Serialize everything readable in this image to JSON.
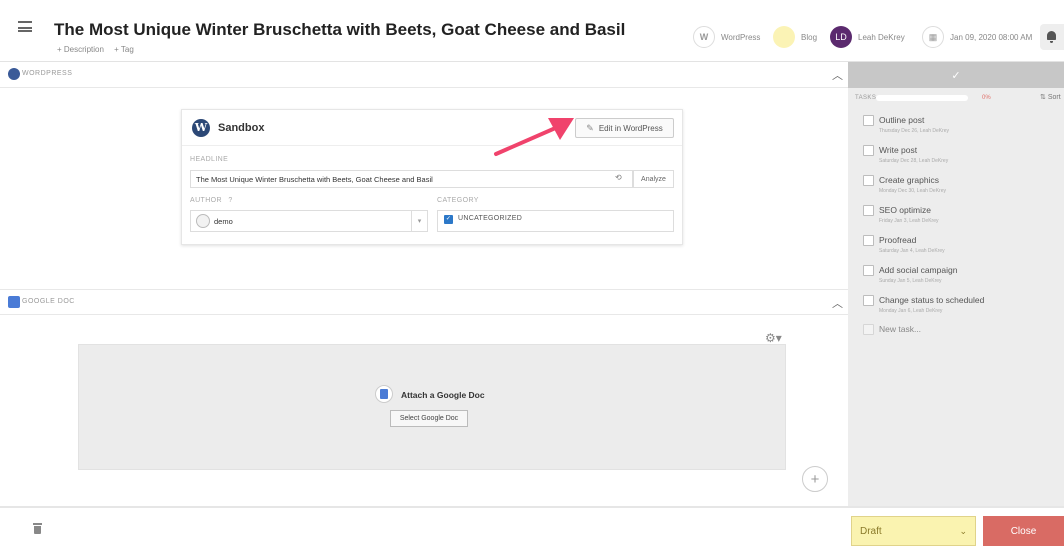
{
  "header": {
    "title": "The Most Unique Winter Bruschetta with Beets, Goat Cheese and Basil",
    "description_link": "+ Description",
    "tag_link": "+ Tag",
    "wordpress_label": "WordPress",
    "blog_label": "Blog",
    "user_initials": "LD",
    "user_name": "Leah DeKrey",
    "date": "Jan 09, 2020 08:00 AM"
  },
  "wordpress_section": {
    "label": "WORDPRESS",
    "site_name": "Sandbox",
    "edit_button": "Edit in WordPress",
    "headline_label": "HEADLINE",
    "headline_value": "The Most Unique Winter Bruschetta with Beets, Goat Cheese and Basil",
    "analyze_button": "Analyze",
    "author_label": "AUTHOR",
    "author_help": "?",
    "author_value": "demo",
    "category_label": "CATEGORY",
    "category_value": "UNCATEGORIZED"
  },
  "google_doc_section": {
    "label": "GOOGLE DOC",
    "attach_text": "Attach a Google Doc",
    "select_button": "Select Google Doc"
  },
  "footer": {
    "status": "Draft",
    "close_button": "Close"
  },
  "tasks": {
    "label": "TASKS",
    "progress_percent": "0%",
    "sort_label": "Sort",
    "items": [
      {
        "name": "Outline post",
        "meta": "Thursday Dec 26,  Leah DeKrey"
      },
      {
        "name": "Write post",
        "meta": "Saturday Dec 28,  Leah DeKrey"
      },
      {
        "name": "Create graphics",
        "meta": "Monday Dec 30,  Leah DeKrey"
      },
      {
        "name": "SEO optimize",
        "meta": "Friday Jan 3,  Leah DeKrey"
      },
      {
        "name": "Proofread",
        "meta": "Saturday Jan 4,  Leah DeKrey"
      },
      {
        "name": "Add social campaign",
        "meta": "Sunday Jan 5,  Leah DeKrey"
      },
      {
        "name": "Change status to scheduled",
        "meta": "Monday Jan 6,  Leah DeKrey"
      }
    ],
    "new_task": "New task..."
  },
  "colors": {
    "accent_arrow": "#f0436c",
    "draft_bg": "#faf3b0",
    "close_bg": "#d96b64",
    "avatar_bg": "#5b2a6e"
  }
}
